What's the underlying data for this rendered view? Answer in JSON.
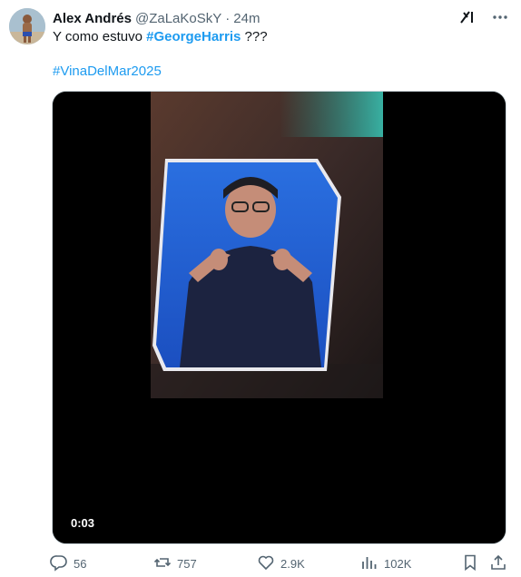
{
  "author": {
    "display_name": "Alex Andrés",
    "handle": "@ZaLaKoSkY",
    "separator": "·",
    "time": "24m"
  },
  "tweet": {
    "text_before": "Y como estuvo ",
    "hashtag1": "#GeorgeHarris",
    "text_after": " ???",
    "hashtag2": "#VinaDelMar2025"
  },
  "media": {
    "duration": "0:03"
  },
  "actions": {
    "replies": "56",
    "reposts": "757",
    "likes": "2.9K",
    "views": "102K"
  },
  "icons": [
    "grok-icon",
    "more-icon",
    "reply-icon",
    "repost-icon",
    "like-icon",
    "views-icon",
    "bookmark-icon",
    "share-icon"
  ],
  "colors": {
    "link": "#1d9bf0",
    "secondary_text": "#536471",
    "primary_text": "#0f1419"
  }
}
